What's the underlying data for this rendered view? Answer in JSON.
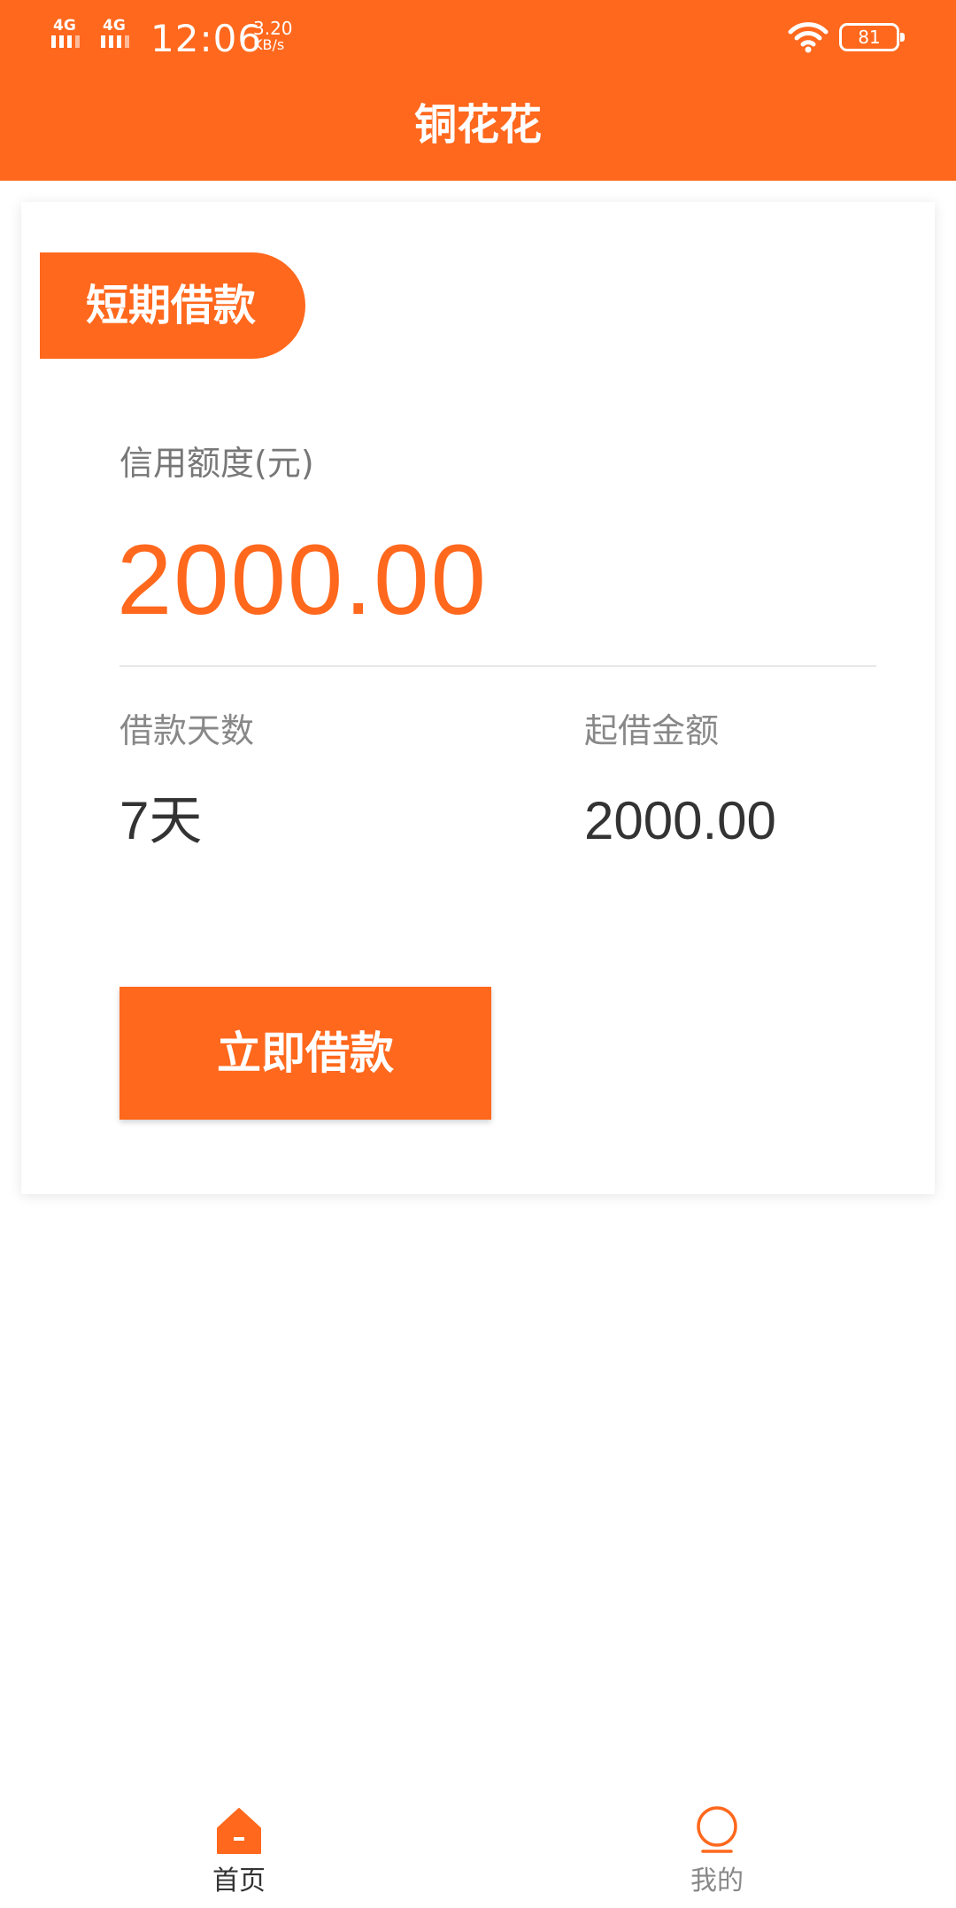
{
  "status_bar": {
    "network1": "4G",
    "network2": "4G",
    "time": "12:06",
    "speed_value": "3.20",
    "speed_unit": "KB/s",
    "battery": "81"
  },
  "header": {
    "title": "铜花花"
  },
  "card": {
    "tag": "短期借款",
    "credit_label": "信用额度(元)",
    "credit_value": "2000.00",
    "days_label": "借款天数",
    "days_value": "7天",
    "min_label": "起借金额",
    "min_value": "2000.00",
    "button_label": "立即借款"
  },
  "bottom_nav": {
    "items": [
      {
        "label": "首页",
        "icon": "home-icon",
        "active": true
      },
      {
        "label": "我的",
        "icon": "profile-icon",
        "active": false
      }
    ]
  },
  "colors": {
    "accent": "#FF681D",
    "active_label": "#333333",
    "inactive_label": "#888888"
  }
}
